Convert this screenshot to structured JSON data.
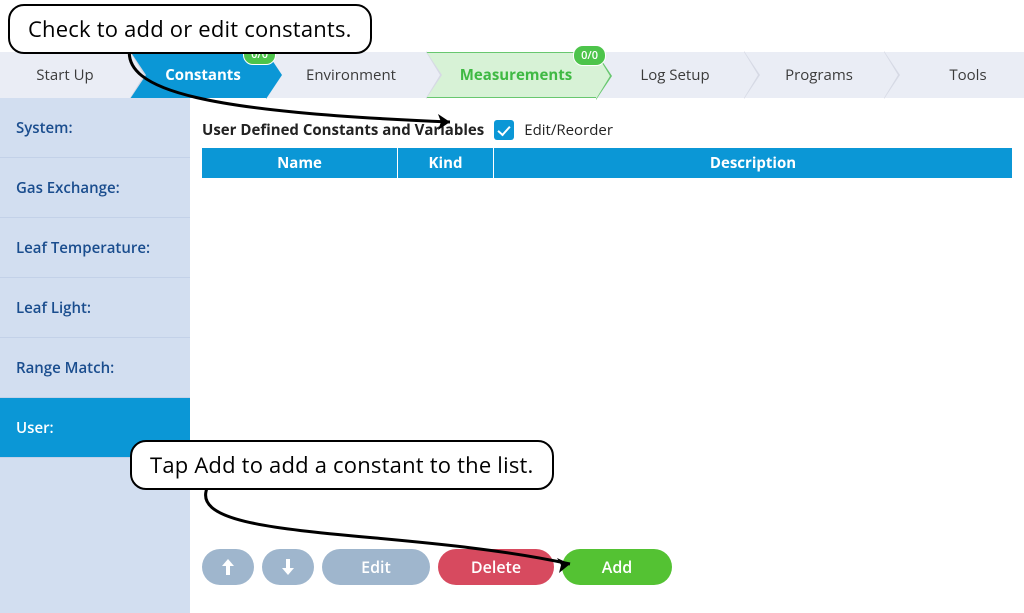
{
  "callouts": {
    "check": "Check to add or edit constants.",
    "add": "Tap Add to add a constant to the list."
  },
  "tabs": {
    "startup": "Start Up",
    "constants": "Constants",
    "environment": "Environment",
    "measurements": "Measurements",
    "logsetup": "Log Setup",
    "programs": "Programs",
    "tools": "Tools",
    "badge_constants": "0/0",
    "badge_measurements": "0/0"
  },
  "sidebar": {
    "system": "System:",
    "gas": "Gas Exchange:",
    "leaftemp": "Leaf Temperature:",
    "leaflight": "Leaf Light:",
    "range": "Range Match:",
    "user": "User:"
  },
  "panel": {
    "title": "User Defined Constants and Variables",
    "edit_reorder": "Edit/Reorder"
  },
  "table": {
    "name": "Name",
    "kind": "Kind",
    "description": "Description"
  },
  "buttons": {
    "edit": "Edit",
    "delete": "Delete",
    "add": "Add"
  }
}
